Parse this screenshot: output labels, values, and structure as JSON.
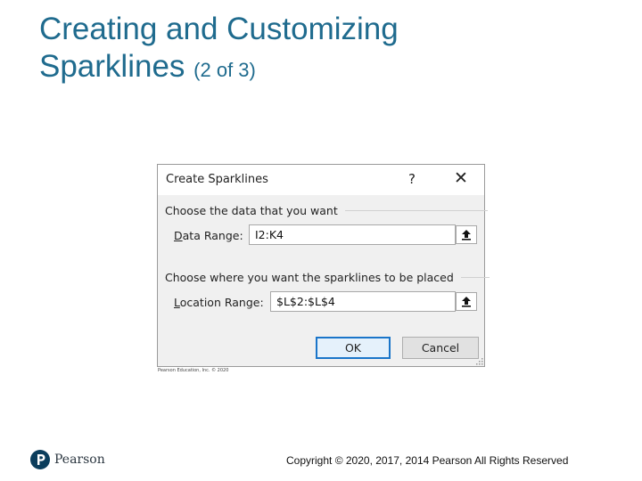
{
  "slide": {
    "title_line1": "Creating and Customizing",
    "title_line2": "Sparklines",
    "subtitle": "(2 of 3)"
  },
  "dialog": {
    "title": "Create Sparklines",
    "help_glyph": "?",
    "close_glyph": "✕",
    "data_group_label": "Choose the data that you want",
    "data_range_label_accel": "D",
    "data_range_label_rest": "ata Range:",
    "data_range_value": "I2:K4",
    "location_group_label": "Choose where you want the sparklines to be placed",
    "location_range_label_accel": "L",
    "location_range_label_rest": "ocation Range:",
    "location_range_value": "$L$2:$L$4",
    "ok_label": "OK",
    "cancel_label": "Cancel"
  },
  "image_credit": "Pearson Education, Inc. © 2020",
  "footer": {
    "logo_text": "Pearson",
    "copyright": "Copyright © 2020, 2017, 2014 Pearson All Rights Reserved"
  },
  "colors": {
    "title": "#1f6b8e",
    "ok_border": "#1a75c9",
    "logo_circle": "#0b3d5c"
  },
  "icons": {
    "collapse_button": "upload-arrow-icon",
    "close": "close-icon",
    "help": "help-icon",
    "resize": "resize-grip-icon",
    "logo": "pearson-p-icon"
  }
}
